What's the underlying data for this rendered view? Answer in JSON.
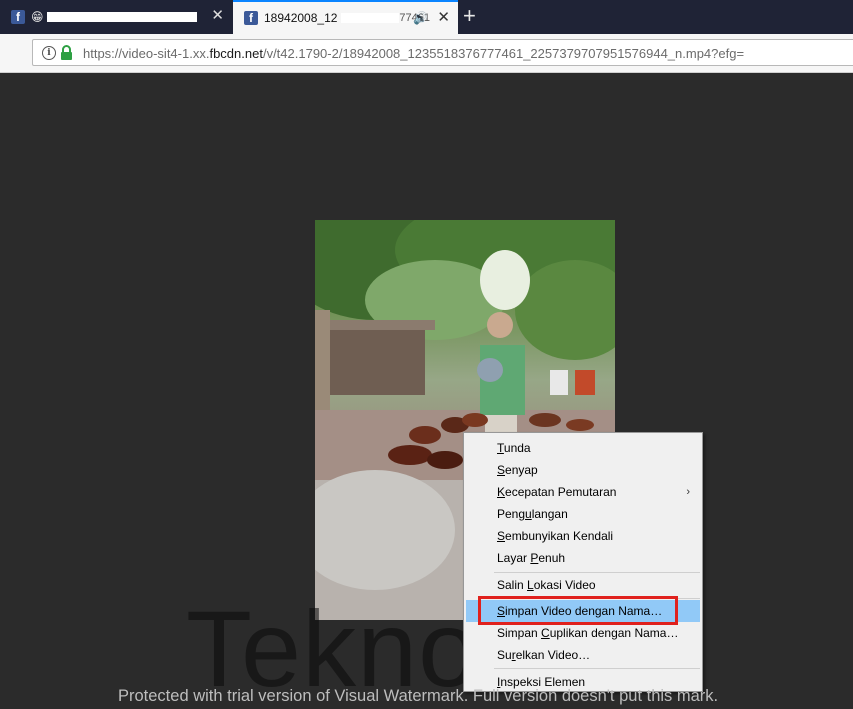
{
  "tabs": [
    {
      "title": "",
      "icon": "facebook-icon",
      "emoji": "😁",
      "active": false
    },
    {
      "title": "18942008_12",
      "title_tail": "77461",
      "icon": "facebook-icon",
      "active": true
    }
  ],
  "new_tab_symbol": "+",
  "tab_close_symbol": "✕",
  "speaker_symbol": "🔊",
  "address": {
    "prefix": "https://video-sit4-1.xx.",
    "domain": "fbcdn.net",
    "path": "/v/t42.1790-2/18942008_1235518376777461_2257379707951576944_n.mp4?efg="
  },
  "context_menu": {
    "items": [
      {
        "label": "Tunda",
        "accel": "T"
      },
      {
        "label": "Senyap",
        "accel": "S"
      },
      {
        "label": "Kecepatan Pemutaran",
        "accel": "K",
        "submenu": true
      },
      {
        "label": "Pengulangan",
        "accel": "u"
      },
      {
        "label": "Sembunyikan Kendali",
        "accel": "S"
      },
      {
        "label": "Layar Penuh",
        "accel": "P"
      },
      {
        "label": "Salin Lokasi Video",
        "accel": "L"
      },
      {
        "label": "Simpan Video dengan Nama…",
        "accel": "S",
        "highlighted": true
      },
      {
        "label": "Simpan Cuplikan dengan Nama…",
        "accel": "C"
      },
      {
        "label": "Surelkan Video…",
        "accel": "r"
      },
      {
        "label": "Inspeksi Elemen",
        "accel": "I"
      }
    ],
    "submenu_arrow": "›"
  },
  "watermark": {
    "brand": "Teknosid",
    "notice": "Protected with trial version of Visual Watermark. Full version doesn't put this mark."
  },
  "colors": {
    "tabstrip": "#1f2336",
    "background": "#2b2b2b",
    "highlight": "#91c9f7",
    "annotation_red": "#e0211d",
    "lock_green": "#2ea043"
  }
}
